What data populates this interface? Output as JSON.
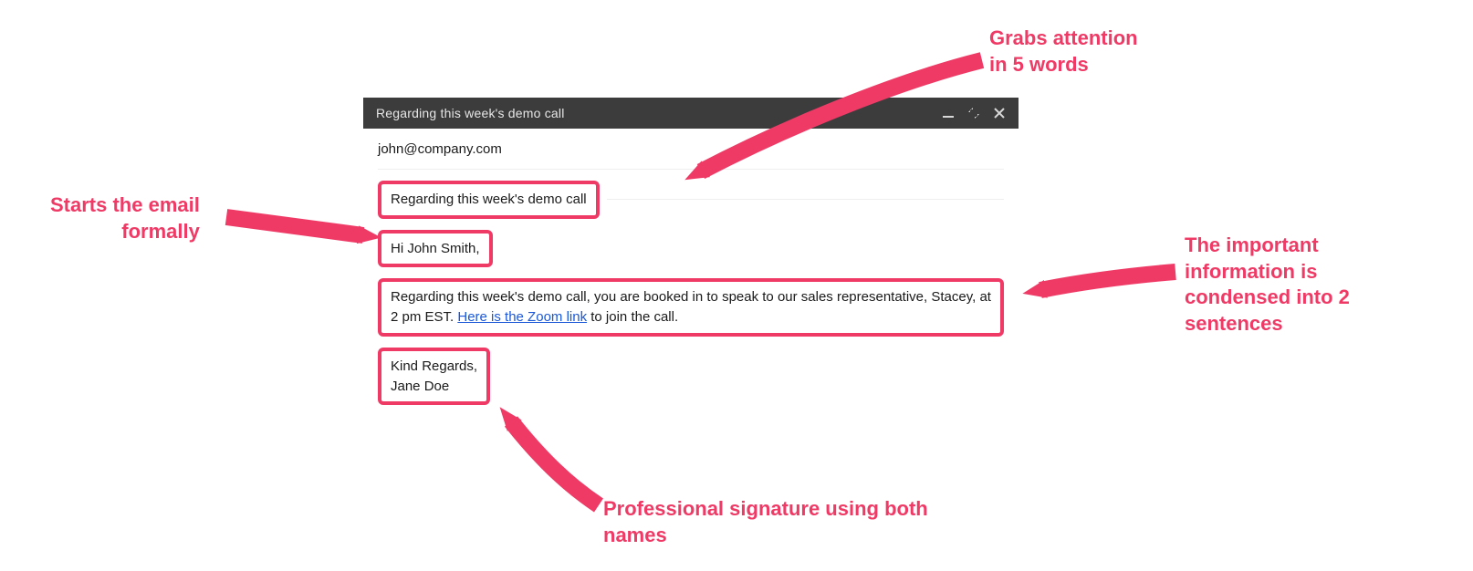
{
  "compose": {
    "header_title": "Regarding this week's demo call",
    "to": "john@company.com",
    "subject": "Regarding this week's demo call",
    "greeting": "Hi John Smith,",
    "body_before_link": "Regarding this week's demo call, you are booked in to speak to our sales representative, Stacey, at 2 pm EST. ",
    "link_text": "Here is the Zoom link",
    "body_after_link": " to join the call.",
    "sig_line1": "Kind Regards,",
    "sig_line2": "Jane Doe"
  },
  "icons": {
    "minimize": "minimize-icon",
    "expand": "expand-icon",
    "close": "close-icon"
  },
  "annotations": {
    "attention_l1": "Grabs attention",
    "attention_l2": "in 5 words",
    "formal_l1": "Starts the email",
    "formal_l2": "formally",
    "condensed_l1": "The important",
    "condensed_l2": "information is",
    "condensed_l3": "condensed into 2",
    "condensed_l4": "sentences",
    "signature_l1": "Professional signature using both",
    "signature_l2": "names"
  },
  "colors": {
    "accent": "#ef3a66",
    "header_bg": "#3c3c3c",
    "link": "#1a58d8"
  }
}
